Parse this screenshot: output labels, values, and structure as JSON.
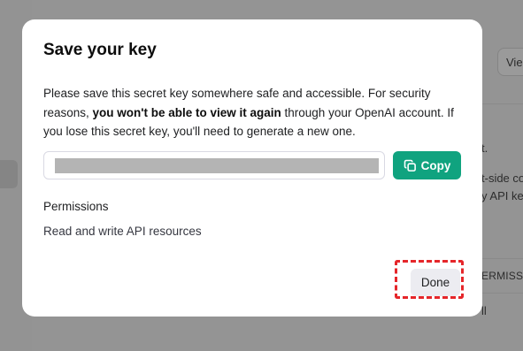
{
  "background": {
    "button_label": "Vie",
    "text_1": "t.",
    "text_2": "t-side co",
    "text_3": "y API ke",
    "column_header": "ERMISSI",
    "row_text": "ll",
    "overlay_color": "#8f8f8f"
  },
  "modal": {
    "title": "Save your key",
    "description": {
      "part1": "Please save this secret key somewhere safe and accessible. For security reasons, ",
      "bold": "you won't be able to view it again",
      "part2": " through your OpenAI account. If you lose this secret key, you'll need to generate a new one."
    },
    "key_field": {
      "value_state": "redacted"
    },
    "copy_button": {
      "label": "Copy",
      "icon": "copy-icon",
      "color": "#10a37f"
    },
    "permissions": {
      "label": "Permissions",
      "value": "Read and write API resources"
    },
    "done_button": {
      "label": "Done"
    },
    "highlight_color": "#e5262a"
  }
}
